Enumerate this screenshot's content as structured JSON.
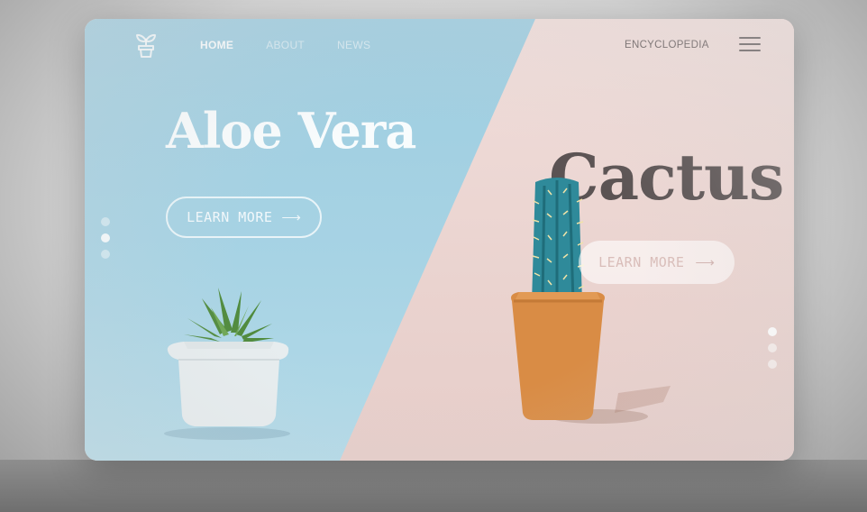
{
  "nav": {
    "links": [
      "HOME",
      "ABOUT",
      "NEWS"
    ],
    "encyclopedia": "ENCYCLOPEDIA"
  },
  "hero": {
    "left_title": "Aloe Vera",
    "left_button": "LEARN MORE",
    "right_title": "Cactus",
    "right_button": "LEARN MORE"
  },
  "icons": {
    "logo": "plant-pot-logo-icon",
    "menu": "hamburger-menu-icon",
    "arrow": "arrow-right-icon"
  },
  "slides": {
    "left_count": 3,
    "left_active_index": 1,
    "right_count": 3,
    "right_active_index": 0
  },
  "colors": {
    "blue_panel": "#a7d3e4",
    "pink_panel": "#ecd8d4",
    "cactus_pot": "#d98c45",
    "aloe_pot": "#e6ecee"
  }
}
